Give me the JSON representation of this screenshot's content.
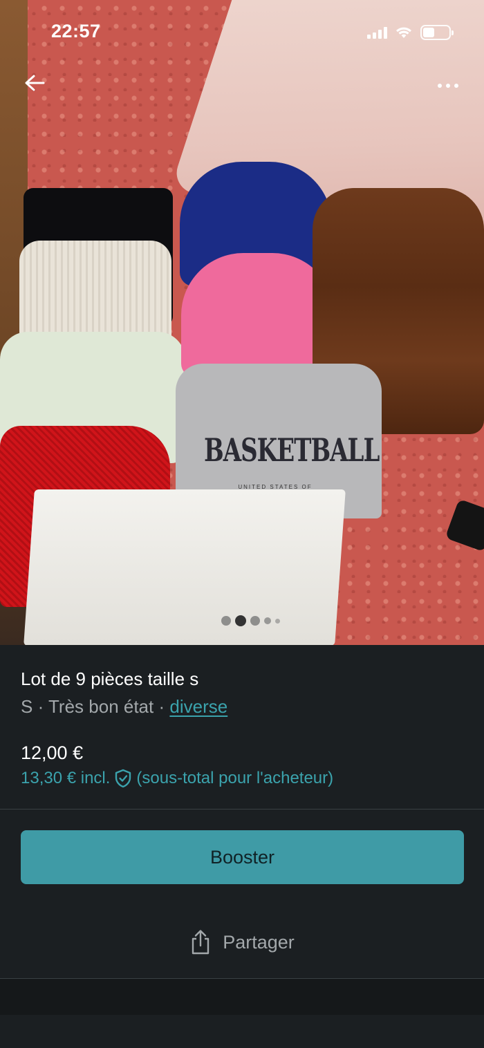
{
  "status_bar": {
    "time": "22:57",
    "battery_level": 0.45
  },
  "listing": {
    "title": "Lot de 9 pièces taille s",
    "size": "S",
    "separator": "·",
    "condition": "Très bon état",
    "brand": "diverse",
    "price": "12,00 €",
    "price_incl": "13,30 € incl.",
    "subtotal_note": "(sous-total pour l'acheteur)"
  },
  "photo": {
    "sweatshirt_print": "BASKETBALL",
    "sweatshirt_subprint": "UNITED STATES OF AMERICA",
    "carousel": {
      "total": 5,
      "active_index": 1
    }
  },
  "actions": {
    "booster_label": "Booster",
    "share_label": "Partager"
  },
  "icons": [
    "back-arrow-icon",
    "more-options-icon",
    "shield-check-icon",
    "share-icon",
    "signal-icon",
    "wifi-icon",
    "battery-icon"
  ],
  "colors": {
    "accent": "#3f9ba6",
    "link": "#3ba3ad",
    "background": "#1b1f22",
    "muted_text": "#a3a8ab"
  }
}
